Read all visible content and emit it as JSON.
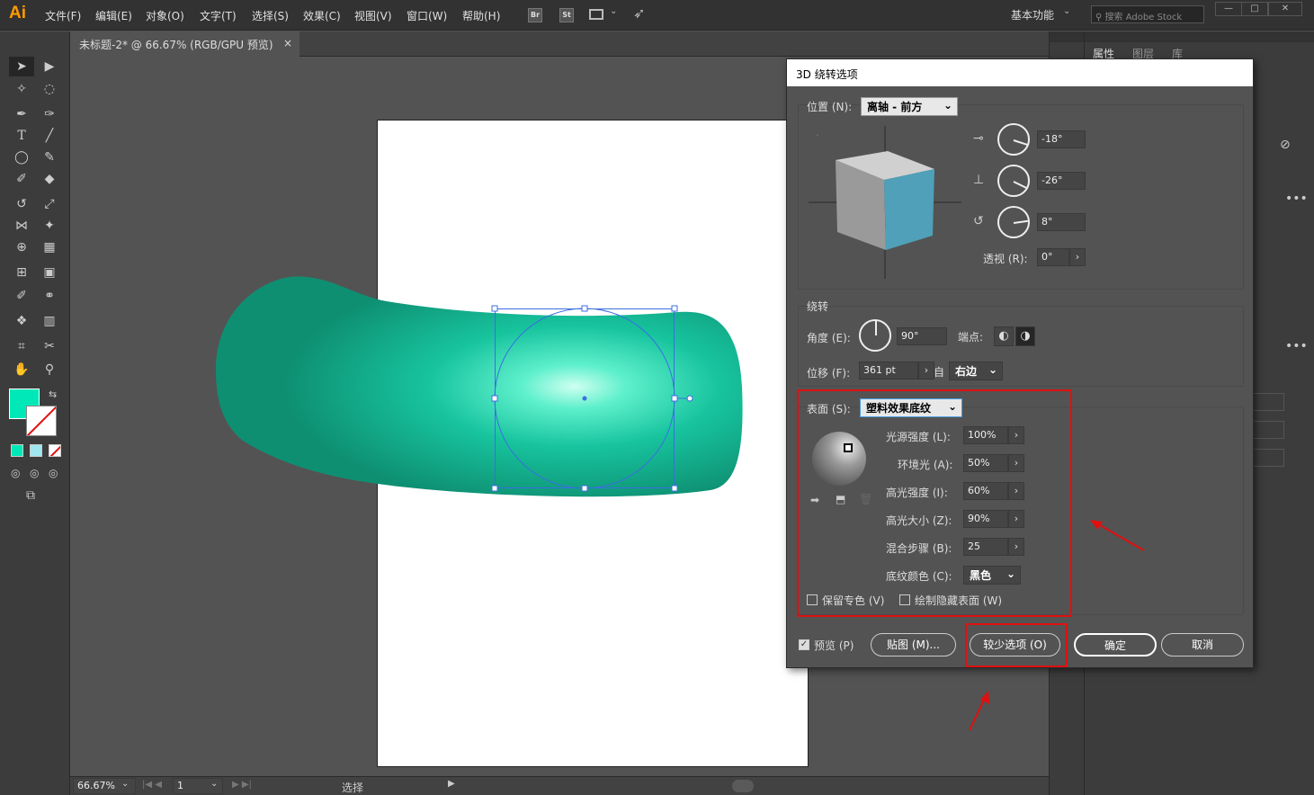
{
  "app": {
    "logo": "Ai"
  },
  "menu": [
    "文件(F)",
    "编辑(E)",
    "对象(O)",
    "文字(T)",
    "选择(S)",
    "效果(C)",
    "视图(V)",
    "窗口(W)",
    "帮助(H)"
  ],
  "menubar_buttons": {
    "br": "Br",
    "st": "St"
  },
  "workspace": "基本功能",
  "stock_placeholder": "搜索 Adobe Stock",
  "doc_tab": {
    "title": "未标题-2* @ 66.67% (RGB/GPU 预览)",
    "close": "×"
  },
  "right_panel": {
    "tabs": [
      "属性",
      "图层",
      "库"
    ]
  },
  "status": {
    "zoom": "66.67%",
    "page": "1",
    "tool": "选择"
  },
  "dialog": {
    "title": "3D 绕转选项",
    "position": {
      "label": "位置 (N):",
      "value": "离轴 - 前方"
    },
    "rotation": {
      "x": "-18°",
      "y": "-26°",
      "z": "8°"
    },
    "perspective": {
      "label": "透视 (R):",
      "value": "0°"
    },
    "revolve": {
      "title": "绕转",
      "angle_label": "角度 (E):",
      "angle_value": "90°",
      "cap_label": "端点:",
      "offset_label": "位移 (F):",
      "offset_value": "361 pt",
      "from_label": "自",
      "from_value": "右边"
    },
    "surface": {
      "label": "表面 (S):",
      "value": "塑料效果底纹",
      "light_intensity_label": "光源强度 (L):",
      "light_intensity": "100%",
      "ambient_label": "环境光 (A):",
      "ambient": "50%",
      "highlight_intensity_label": "高光强度 (I):",
      "highlight_intensity": "60%",
      "highlight_size_label": "高光大小 (Z):",
      "highlight_size": "90%",
      "blend_steps_label": "混合步骤 (B):",
      "blend_steps": "25",
      "shade_color_label": "底纹颜色 (C):",
      "shade_color": "黑色",
      "preserve_spot": "保留专色 (V)",
      "draw_hidden": "绘制隐藏表面 (W)"
    },
    "preview": "预览 (P)",
    "map_button": "贴图 (M)...",
    "fewer_options_button": "较少选项 (O)",
    "ok_button": "确定",
    "cancel_button": "取消"
  },
  "colors": {
    "accent_red": "#e01010",
    "shape_teal": "#16b08e",
    "cube_face": "#4fa0b8",
    "fill_swatch": "#00e8b8"
  }
}
